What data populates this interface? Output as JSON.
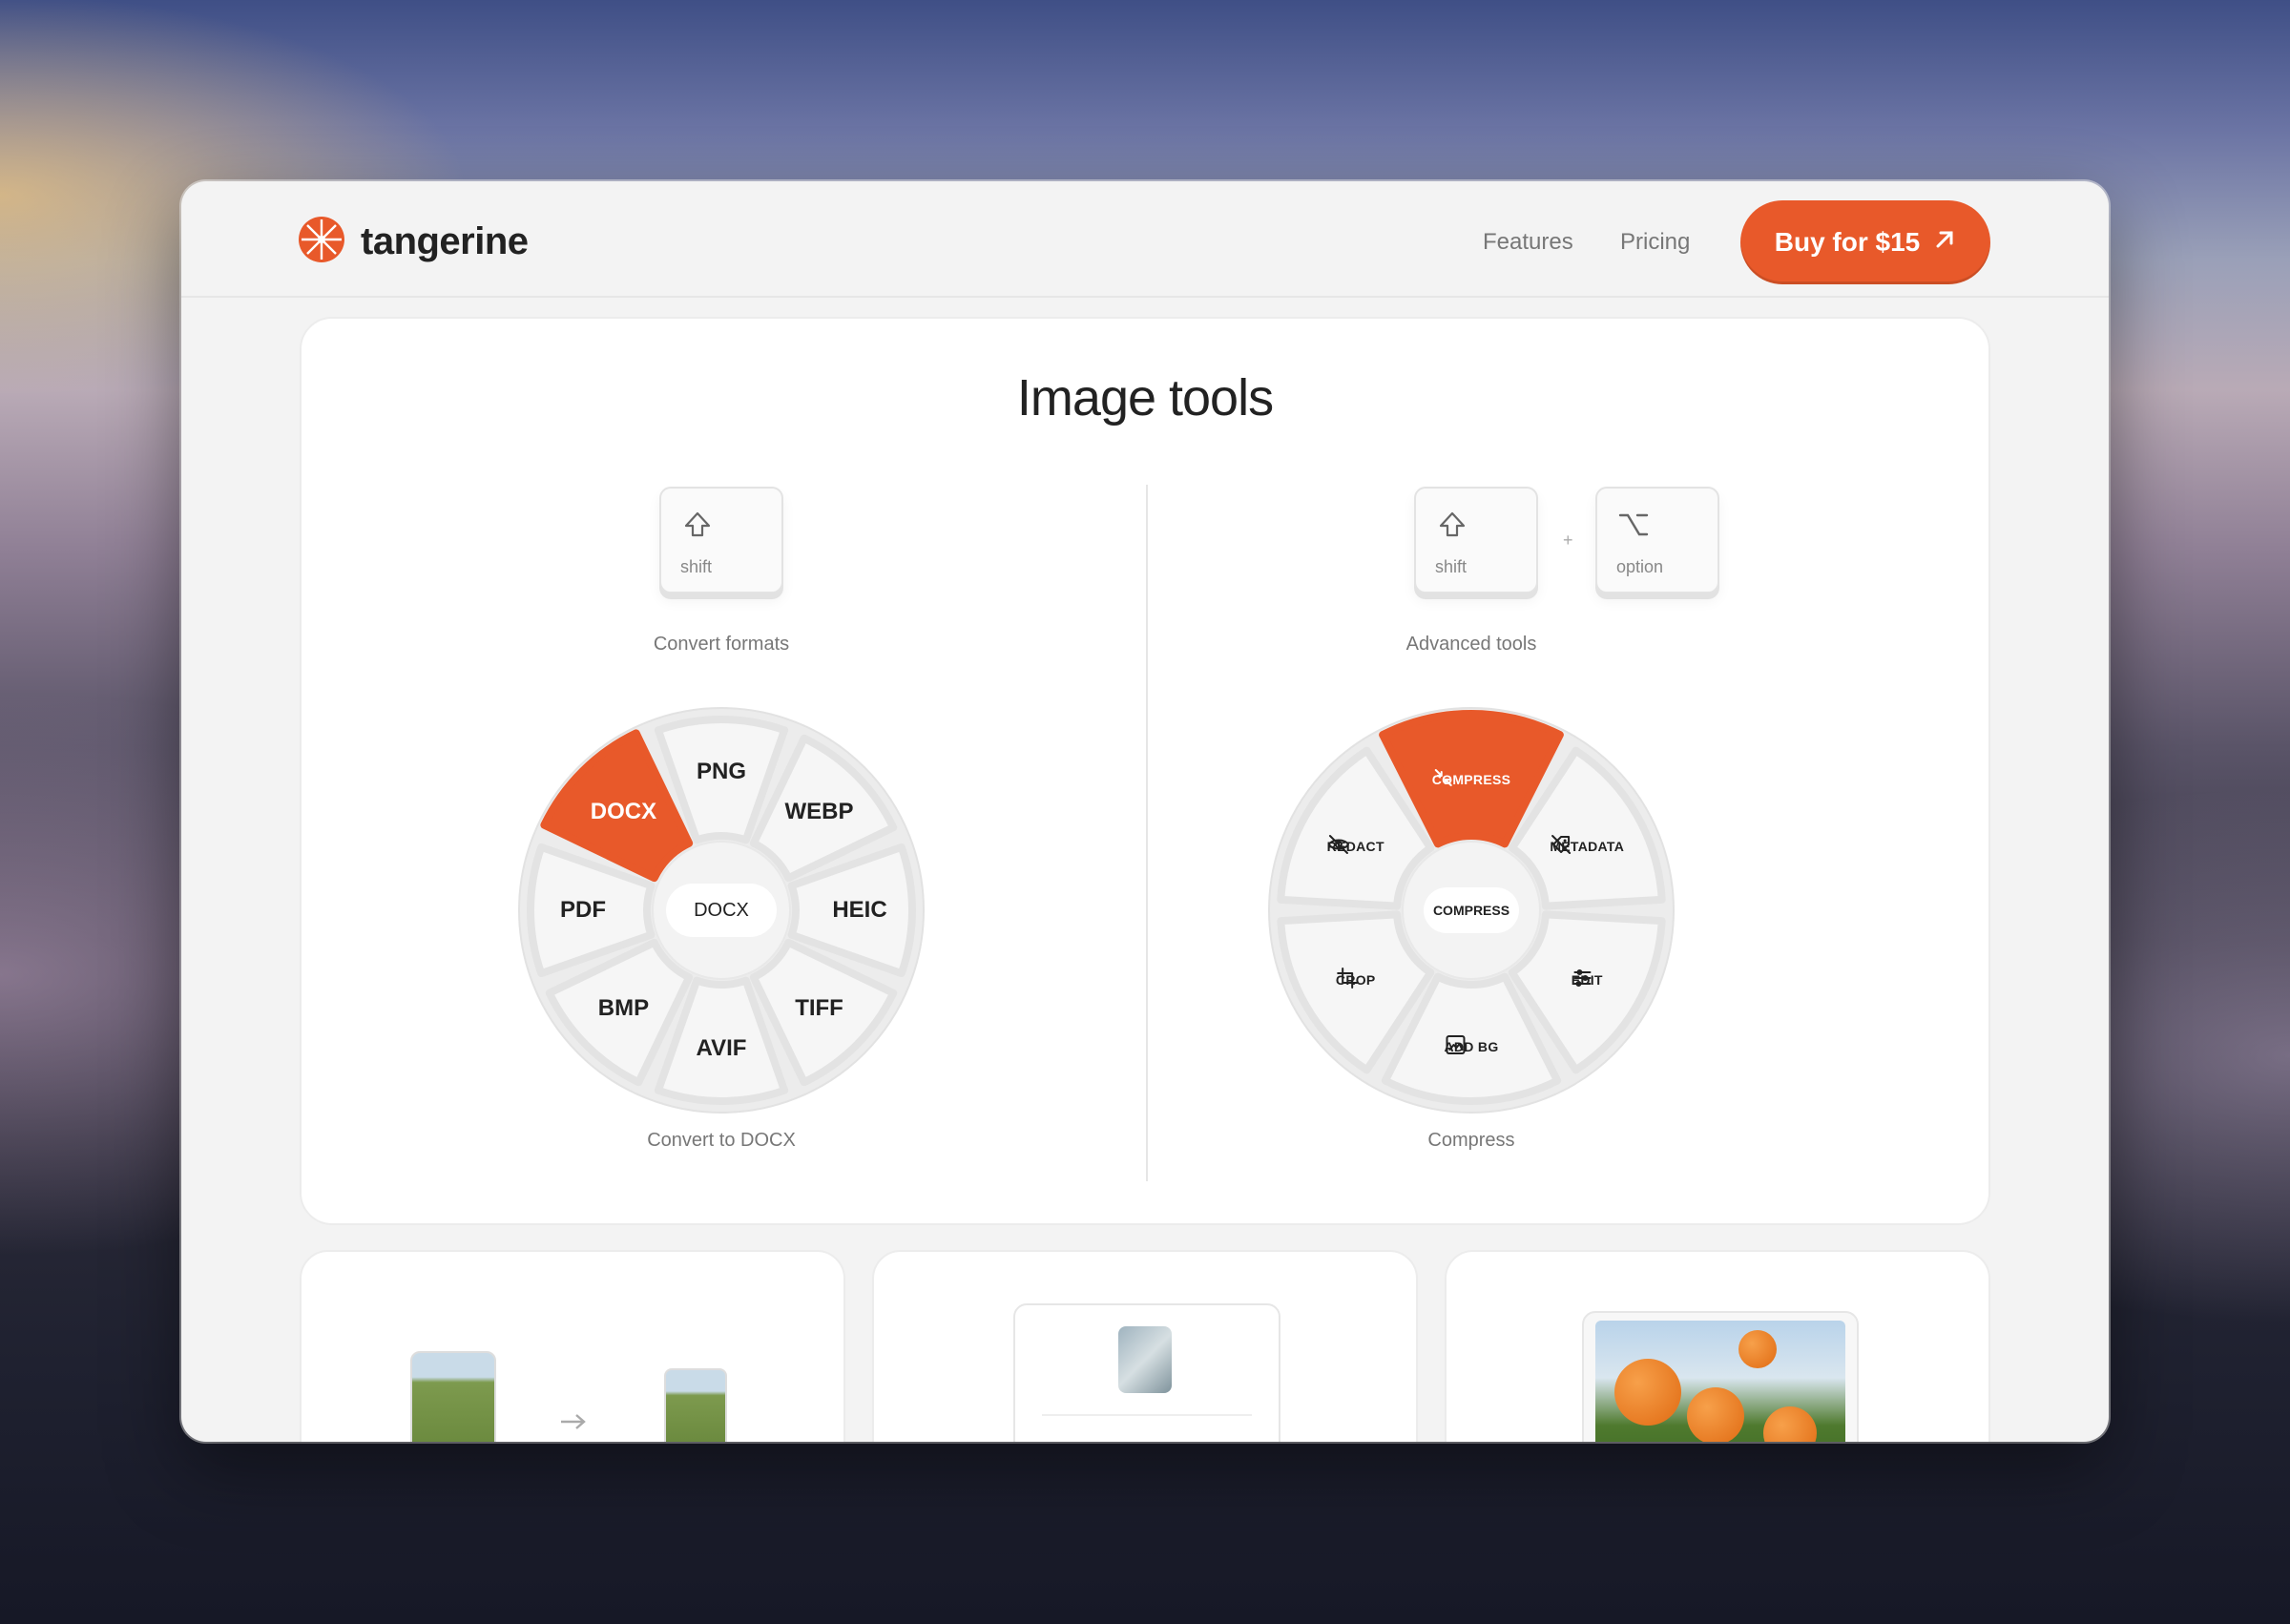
{
  "brand": {
    "name": "tangerine"
  },
  "nav": {
    "features": "Features",
    "pricing": "Pricing",
    "buy": "Buy for $15"
  },
  "section": {
    "title": "Image tools"
  },
  "left": {
    "keys": [
      {
        "label": "shift"
      }
    ],
    "caption": "Convert formats",
    "formats": [
      "DOCX",
      "PNG",
      "WEBP",
      "HEIC",
      "TIFF",
      "AVIF",
      "BMP",
      "PDF"
    ],
    "selected": "DOCX",
    "center": "DOCX",
    "result": "Convert to DOCX"
  },
  "right": {
    "keys": [
      {
        "label": "shift"
      },
      {
        "label": "option"
      }
    ],
    "plus": "+",
    "caption": "Advanced tools",
    "tools": [
      {
        "label": "COMPRESS",
        "icon": "compress-icon"
      },
      {
        "label": "METADATA",
        "icon": "metadata-off-icon"
      },
      {
        "label": "EDIT",
        "icon": "sliders-icon"
      },
      {
        "label": "ADD BG",
        "icon": "image-frame-icon"
      },
      {
        "label": "CROP",
        "icon": "crop-icon"
      },
      {
        "label": "REDACT",
        "icon": "eye-off-icon"
      }
    ],
    "selected": "COMPRESS",
    "center": "COMPRESS",
    "result": "Compress"
  },
  "colors": {
    "accent": "#e8592a",
    "text": "#222222",
    "muted": "#777777"
  }
}
